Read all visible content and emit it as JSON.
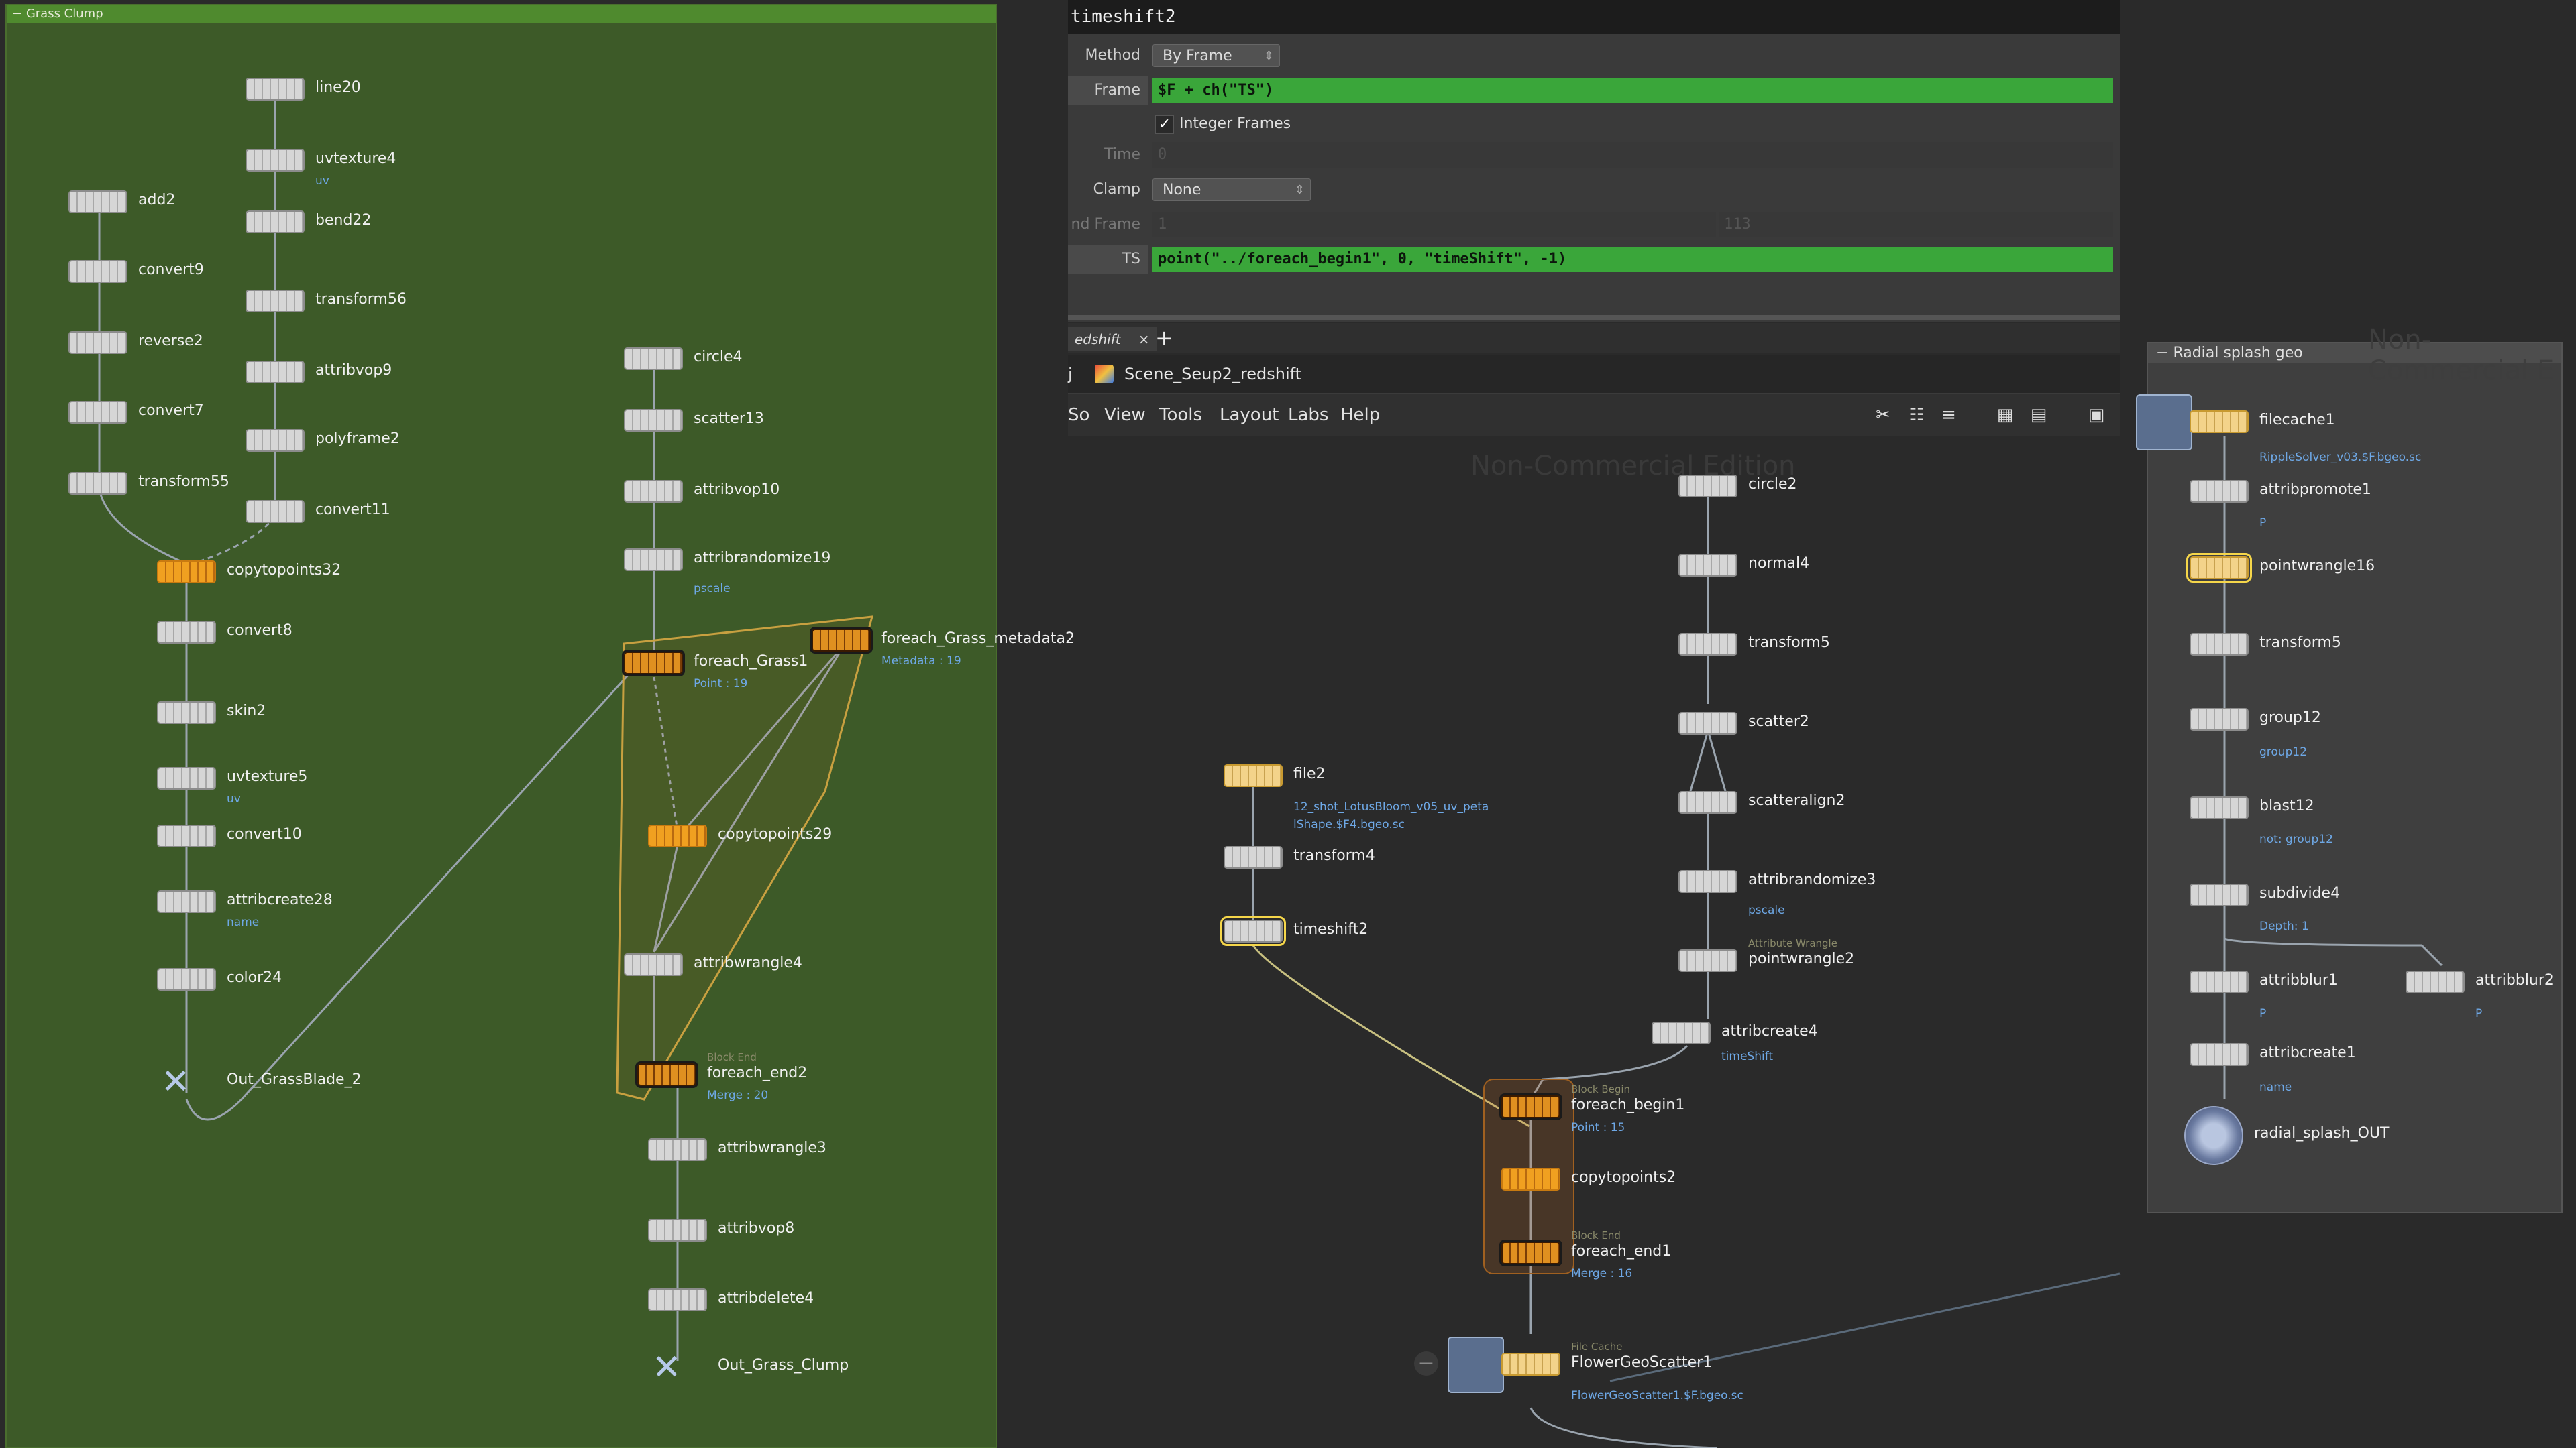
{
  "param_pane": {
    "node_name": "timeshift2",
    "method_label": "Method",
    "method_value": "By Frame",
    "frame_label": "Frame",
    "frame_expr": "$F + ch(\"TS\")",
    "integer_frames_label": "Integer Frames",
    "time_label": "Time",
    "time_value": "0",
    "clamp_label": "Clamp",
    "clamp_value": "None",
    "end_frame_label": "nd Frame",
    "end_frame_a": "1",
    "end_frame_b": "113",
    "ts_label": "TS",
    "ts_expr": "point(\"../foreach_begin1\", 0, \"timeShift\", -1)"
  },
  "tabs": {
    "active": "edshift",
    "close": "×",
    "add": "+"
  },
  "path_bar": {
    "prefix": "j",
    "path": "Scene_Seup2_redshift"
  },
  "menu": {
    "items": [
      "So",
      "View",
      "Tools",
      "Layout",
      "Labs",
      "Help"
    ]
  },
  "watermark": {
    "main": "Non-Commercial Edition",
    "right": "Non-Commercial E"
  },
  "grass_box": {
    "title": "Grass Clump"
  },
  "radial_box": {
    "title": "Radial splash geo"
  },
  "nodes": {
    "line20": "line20",
    "uvtexture4": "uvtexture4",
    "uvtexture4_sub": "uv",
    "bend22": "bend22",
    "transform56": "transform56",
    "attribvop9": "attribvop9",
    "polyframe2": "polyframe2",
    "convert11": "convert11",
    "add2": "add2",
    "convert9": "convert9",
    "reverse2": "reverse2",
    "convert7": "convert7",
    "transform55": "transform55",
    "copytopoints32": "copytopoints32",
    "convert8": "convert8",
    "skin2": "skin2",
    "uvtexture5": "uvtexture5",
    "uvtexture5_sub": "uv",
    "convert10": "convert10",
    "attribcreate28": "attribcreate28",
    "attribcreate28_sub": "name",
    "color24": "color24",
    "out_grassblade": "Out_GrassBlade_2",
    "circle4": "circle4",
    "scatter13": "scatter13",
    "attribvop10": "attribvop10",
    "attribrandomize19": "attribrandomize19",
    "attribrandomize19_sub": "pscale",
    "foreach_grass1": "foreach_Grass1",
    "foreach_grass1_sub": "Point : 19",
    "foreach_grass_metadata2": "foreach_Grass_metadata2",
    "foreach_grass_metadata2_sub": "Metadata : 19",
    "copytopoints29": "copytopoints29",
    "attribwrangle4": "attribwrangle4",
    "foreach_end2": "foreach_end2",
    "foreach_end2_sub": "Merge : 20",
    "foreach_end2_hint": "Block End",
    "attribwrangle3": "attribwrangle3",
    "attribvop8": "attribvop8",
    "attribdelete4": "attribdelete4",
    "out_grass_clump": "Out_Grass_Clump",
    "file2": "file2",
    "file2_sub1": "12_shot_LotusBloom_v05_uv_peta",
    "file2_sub2": "lShape.$F4.bgeo.sc",
    "transform4": "transform4",
    "timeshift2": "timeshift2",
    "circle2": "circle2",
    "normal4": "normal4",
    "transform5a": "transform5",
    "scatter2": "scatter2",
    "scatteralign2": "scatteralign2",
    "attribrandomize3": "attribrandomize3",
    "attribrandomize3_sub": "pscale",
    "pointwrangle2": "pointwrangle2",
    "pointwrangle2_hint": "Attribute Wrangle",
    "attribcreate4": "attribcreate4",
    "attribcreate4_sub": "timeShift",
    "foreach_begin1": "foreach_begin1",
    "foreach_begin1_sub": "Point : 15",
    "foreach_begin1_hint": "Block Begin",
    "copytopoints2": "copytopoints2",
    "foreach_end1": "foreach_end1",
    "foreach_end1_sub": "Merge : 16",
    "foreach_end1_hint": "Block End",
    "flowergeoscatter1": "FlowerGeoScatter1",
    "flowergeoscatter1_sub": "FlowerGeoScatter1.$F.bgeo.sc",
    "flowergeoscatter1_hint": "File Cache",
    "filecache1": "filecache1",
    "filecache1_sub": "RippleSolver_v03.$F.bgeo.sc",
    "attribpromote1": "attribpromote1",
    "attribpromote1_sub": "P",
    "pointwrangle16": "pointwrangle16",
    "transform5b": "transform5",
    "group12": "group12",
    "group12_sub": "group12",
    "blast12": "blast12",
    "blast12_sub": "not: group12",
    "subdivide4": "subdivide4",
    "subdivide4_sub": "Depth: 1",
    "attribblur1": "attribblur1",
    "attribblur1_sub": "P",
    "attribblur2": "attribblur2",
    "attribblur2_sub": "P",
    "attribcreate1": "attribcreate1",
    "attribcreate1_sub": "name",
    "radial_splash_out": "radial_splash_OUT"
  },
  "colors": {
    "grass_box_bg": "#3d5a28",
    "grass_box_title": "#4f8a2e",
    "expression_green": "#3aa63a",
    "node_orange": "#f0a020",
    "node_selected": "#f5d64a",
    "subtext_blue": "#6ea8e6"
  }
}
